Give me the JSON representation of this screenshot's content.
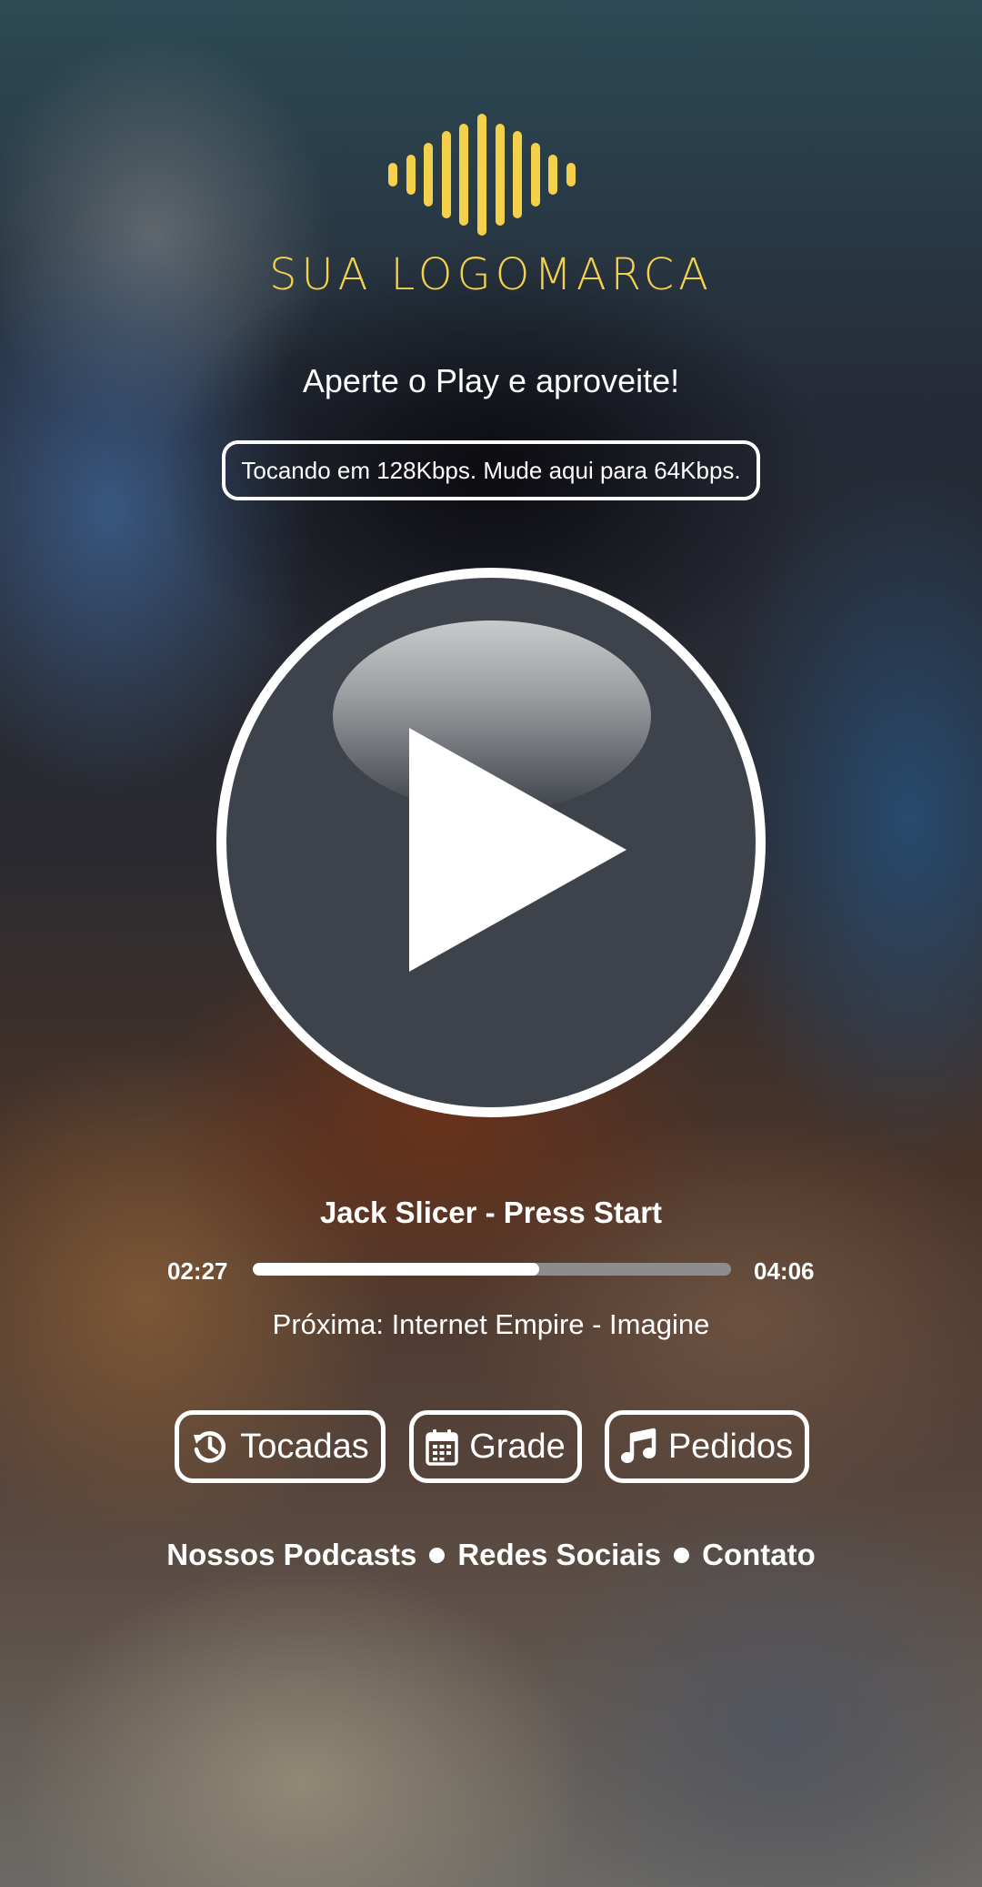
{
  "brand": {
    "logo_text": "SUA LOGOMARCA",
    "accent_color": "#f5d04a"
  },
  "tagline": "Aperte o Play e aproveite!",
  "quality_toggle": {
    "label": "Tocando em 128Kbps. Mude aqui para 64Kbps."
  },
  "player": {
    "play_icon": "play-icon",
    "track_title": "Jack Slicer - Press Start",
    "current_time": "02:27",
    "total_time": "04:06",
    "progress_percent": 59.8,
    "next_track": "Próxima: Internet Empire - Imagine"
  },
  "actions": [
    {
      "label": "Tocadas",
      "icon": "history-icon"
    },
    {
      "label": "Grade",
      "icon": "calendar-icon"
    },
    {
      "label": "Pedidos",
      "icon": "music-note-icon"
    }
  ],
  "footer_links": [
    "Nossos Podcasts",
    "Redes Sociais",
    "Contato"
  ]
}
